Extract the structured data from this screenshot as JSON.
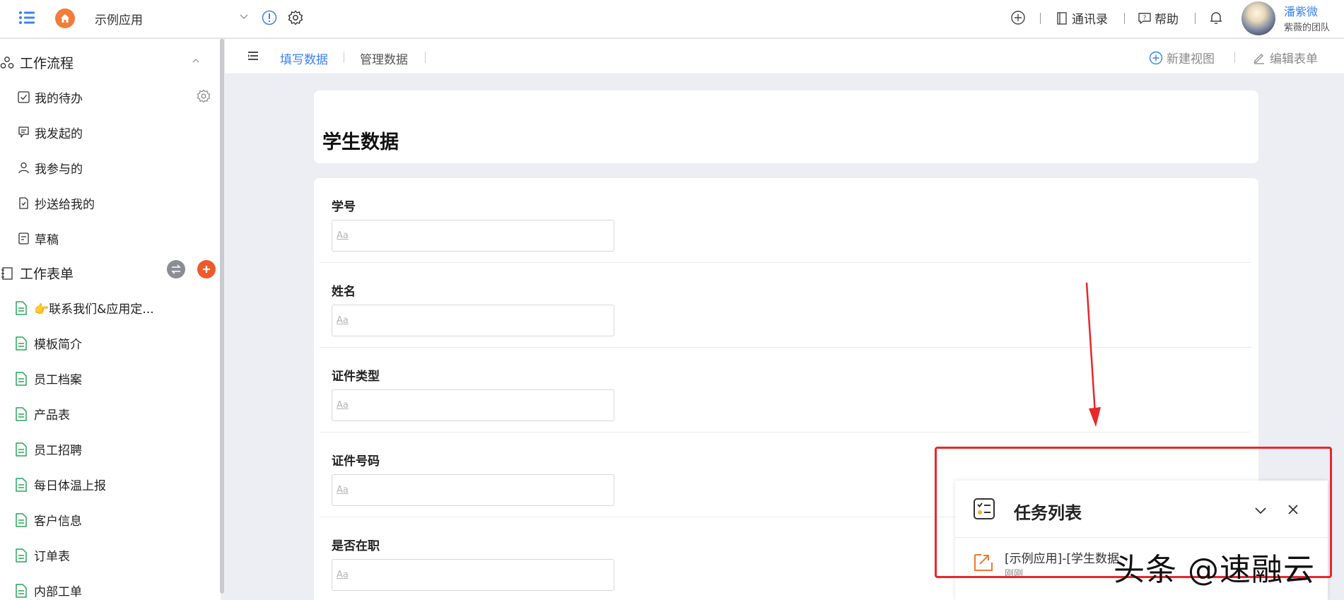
{
  "topbar": {
    "app_name": "示例应用",
    "contacts_label": "通讯录",
    "help_label": "帮助",
    "user_name": "潘紫微",
    "user_team": "紫薇的团队"
  },
  "sidebar": {
    "workflow_title": "工作流程",
    "workflow_items": [
      {
        "label": "我的待办",
        "icon": "checkbox-icon"
      },
      {
        "label": "我发起的",
        "icon": "flag-doc-icon"
      },
      {
        "label": "我参与的",
        "icon": "person-icon"
      },
      {
        "label": "抄送给我的",
        "icon": "copy-doc-icon"
      },
      {
        "label": "草稿",
        "icon": "draft-icon"
      }
    ],
    "forms_title": "工作表单",
    "forms": [
      {
        "label": "👉联系我们&应用定..."
      },
      {
        "label": "模板简介"
      },
      {
        "label": "员工档案"
      },
      {
        "label": "产品表"
      },
      {
        "label": "员工招聘"
      },
      {
        "label": "每日体温上报"
      },
      {
        "label": "客户信息"
      },
      {
        "label": "订单表"
      },
      {
        "label": "内部工单"
      }
    ]
  },
  "subbar": {
    "tab_fill": "填写数据",
    "tab_manage": "管理数据",
    "new_view": "新建视图",
    "edit_form": "编辑表单"
  },
  "form": {
    "title": "学生数据",
    "fields": [
      {
        "label": "学号",
        "placeholder": "Aa"
      },
      {
        "label": "姓名",
        "placeholder": "Aa"
      },
      {
        "label": "证件类型",
        "placeholder": "Aa"
      },
      {
        "label": "证件号码",
        "placeholder": "Aa"
      },
      {
        "label": "是否在职",
        "placeholder": "Aa"
      }
    ]
  },
  "task_panel": {
    "title": "任务列表",
    "row_text": "[示例应用]-[学生数据",
    "row_time": "刚刚"
  },
  "watermark": "头条 @速融云",
  "colors": {
    "accent": "#3b82f6",
    "home": "#f27c3a",
    "highlight": "#e8272a",
    "form_icon": "#2aa55a"
  }
}
